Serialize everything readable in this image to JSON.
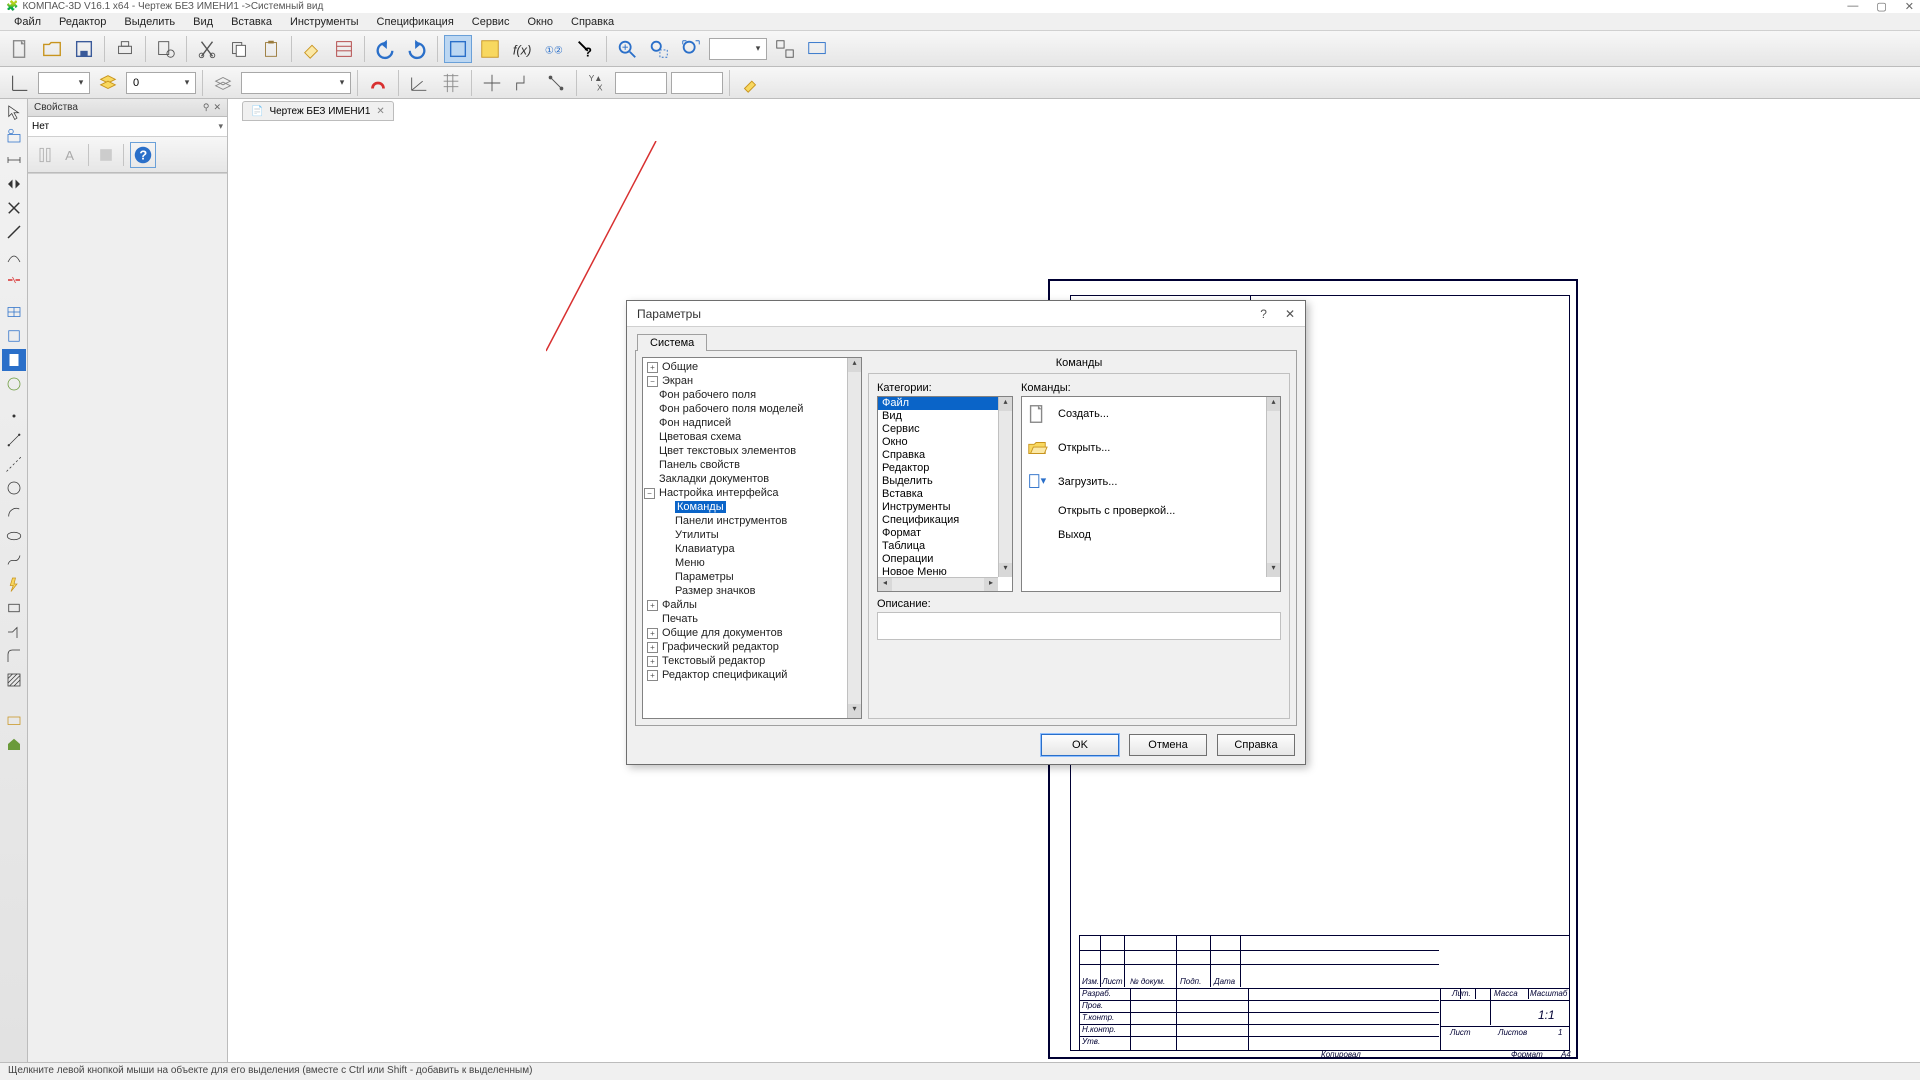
{
  "title": "КОМПАС-3D V16.1 x64 - Чертеж БЕЗ ИМЕНИ1 ->Системный вид",
  "menu": [
    "Файл",
    "Редактор",
    "Выделить",
    "Вид",
    "Вставка",
    "Инструменты",
    "Спецификация",
    "Сервис",
    "Окно",
    "Справка"
  ],
  "panel": {
    "title": "Свойства",
    "row1": "Нет"
  },
  "doc_tab": "Чертеж БЕЗ ИМЕНИ1",
  "layer_num": "0",
  "titleblock": {
    "izm": "Изм.",
    "list": "Лист",
    "ndokum": "№ докум.",
    "podp": "Подп.",
    "data": "Дата",
    "razrab": "Разраб.",
    "prov": "Пров.",
    "tkontr": "Т.контр.",
    "nkontr": "Н.контр.",
    "utv": "Утв.",
    "lit": "Лит.",
    "massa": "Масса",
    "masshtab": "Масштаб",
    "scale": "1:1",
    "list2": "Лист",
    "listov": "Листов",
    "one": "1",
    "kopiroval": "Копировал",
    "format": "Формат",
    "a4": "А4"
  },
  "dialog": {
    "title": "Параметры",
    "tab": "Система",
    "group_title": "Команды",
    "tree": {
      "general": "Общие",
      "screen": "Экран",
      "bg_work": "Фон рабочего поля",
      "bg_model": "Фон рабочего поля моделей",
      "bg_caption": "Фон надписей",
      "color_scheme": "Цветовая схема",
      "text_color": "Цвет текстовых элементов",
      "prop_panel": "Панель свойств",
      "doc_tabs": "Закладки документов",
      "ui_setup": "Настройка интерфейса",
      "commands": "Команды",
      "toolbars": "Панели инструментов",
      "utilities": "Утилиты",
      "keyboard": "Клавиатура",
      "menu": "Меню",
      "parameters": "Параметры",
      "icon_size": "Размер значков",
      "files": "Файлы",
      "print": "Печать",
      "doc_common": "Общие для документов",
      "graph_editor": "Графический редактор",
      "text_editor": "Текстовый редактор",
      "spec_editor": "Редактор спецификаций"
    },
    "cat_label": "Категории:",
    "categories": [
      "Файл",
      "Вид",
      "Сервис",
      "Окно",
      "Справка",
      "Редактор",
      "Выделить",
      "Вставка",
      "Инструменты",
      "Спецификация",
      "Формат",
      "Таблица",
      "Операции",
      "Новое Меню"
    ],
    "cmd_label": "Команды:",
    "commands": [
      "Создать...",
      "Открыть...",
      "Загрузить...",
      "Открыть с проверкой...",
      "Выход"
    ],
    "desc_label": "Описание:",
    "btn_ok": "OK",
    "btn_cancel": "Отмена",
    "btn_help": "Справка"
  },
  "status": "Щелкните левой кнопкой мыши на объекте для его выделения (вместе с Ctrl или Shift - добавить к выделенным)"
}
